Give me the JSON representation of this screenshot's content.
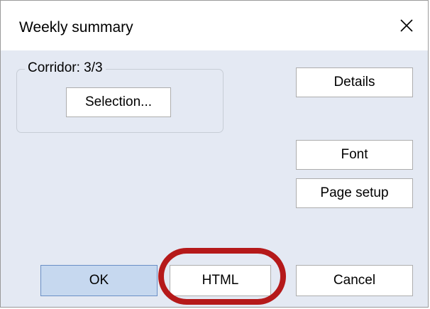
{
  "dialog": {
    "title": "Weekly summary",
    "close_glyph": "✕"
  },
  "group": {
    "label": "Corridor: 3/3",
    "selection_button": "Selection..."
  },
  "side_buttons": {
    "details": "Details",
    "font": "Font",
    "page_setup": "Page setup"
  },
  "footer_buttons": {
    "ok": "OK",
    "html": "HTML",
    "cancel": "Cancel"
  },
  "colors": {
    "highlight_ring": "#b5191a",
    "default_button": "#c6d8ef",
    "dialog_background": "#e4e9f3"
  }
}
